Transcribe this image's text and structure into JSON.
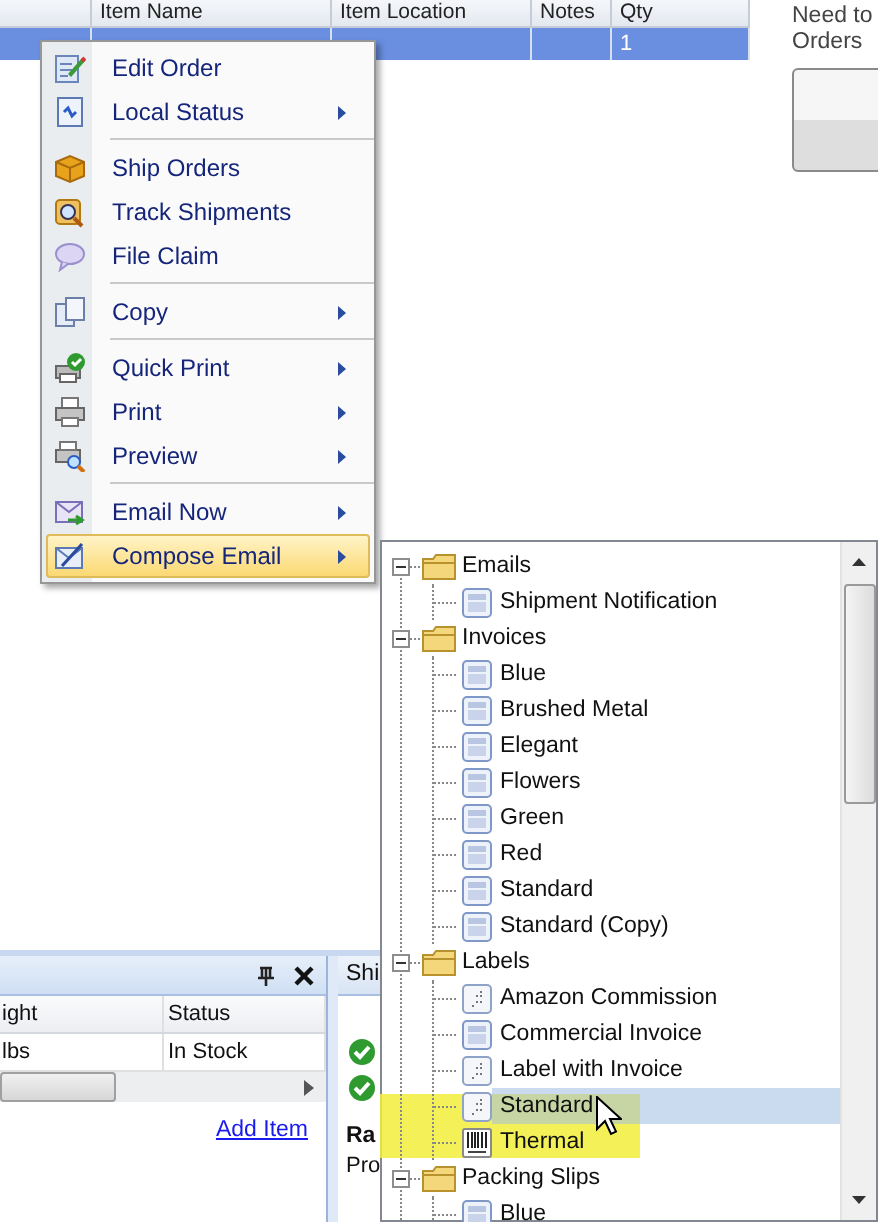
{
  "orders_table": {
    "columns": [
      "Item Name",
      "Item Location",
      "Notes",
      "Qty"
    ],
    "rows": [
      {
        "selected": true,
        "qty": "1"
      }
    ]
  },
  "side_panel": {
    "text_lines": [
      "Need to",
      "Orders"
    ]
  },
  "items_panel": {
    "columns": [
      "ight",
      "Status"
    ],
    "rows": [
      [
        "lbs",
        "In Stock"
      ]
    ],
    "link": "Add Item"
  },
  "shipments_panel": {
    "tab": "Shi",
    "heading": "Ra",
    "label": "Pro"
  },
  "context_menu": {
    "items": [
      {
        "kind": "item",
        "label": "Edit Order",
        "submenu": false,
        "selected": false
      },
      {
        "kind": "item",
        "label": "Local Status",
        "submenu": true,
        "selected": false
      },
      {
        "kind": "separator"
      },
      {
        "kind": "item",
        "label": "Ship Orders",
        "submenu": false,
        "selected": false
      },
      {
        "kind": "item",
        "label": "Track Shipments",
        "submenu": false,
        "selected": false
      },
      {
        "kind": "item",
        "label": "File Claim",
        "submenu": false,
        "selected": false
      },
      {
        "kind": "separator"
      },
      {
        "kind": "item",
        "label": "Copy",
        "submenu": true,
        "selected": false
      },
      {
        "kind": "separator"
      },
      {
        "kind": "item",
        "label": "Quick Print",
        "submenu": true,
        "selected": false
      },
      {
        "kind": "item",
        "label": "Print",
        "submenu": true,
        "selected": false
      },
      {
        "kind": "item",
        "label": "Preview",
        "submenu": true,
        "selected": false
      },
      {
        "kind": "separator"
      },
      {
        "kind": "item",
        "label": "Email Now",
        "submenu": true,
        "selected": false
      },
      {
        "kind": "item",
        "label": "Compose Email",
        "submenu": true,
        "selected": true
      }
    ]
  },
  "template_tree": {
    "groups": [
      {
        "label": "Emails",
        "expanded": true,
        "children": [
          {
            "label": "Shipment Notification",
            "kind": "document",
            "selected": false
          }
        ]
      },
      {
        "label": "Invoices",
        "expanded": true,
        "children": [
          {
            "label": "Blue",
            "kind": "document",
            "selected": false
          },
          {
            "label": "Brushed Metal",
            "kind": "document",
            "selected": false
          },
          {
            "label": "Elegant",
            "kind": "document",
            "selected": false
          },
          {
            "label": "Flowers",
            "kind": "document",
            "selected": false
          },
          {
            "label": "Green",
            "kind": "document",
            "selected": false
          },
          {
            "label": "Red",
            "kind": "document",
            "selected": false
          },
          {
            "label": "Standard",
            "kind": "document",
            "selected": false
          },
          {
            "label": "Standard (Copy)",
            "kind": "document",
            "selected": false
          }
        ]
      },
      {
        "label": "Labels",
        "expanded": true,
        "children": [
          {
            "label": "Amazon Commission",
            "kind": "label",
            "selected": false
          },
          {
            "label": "Commercial Invoice",
            "kind": "document",
            "selected": false
          },
          {
            "label": "Label with Invoice",
            "kind": "label",
            "selected": false
          },
          {
            "label": "Standard",
            "kind": "label",
            "selected": true
          },
          {
            "label": "Thermal",
            "kind": "barcode",
            "selected": false
          }
        ]
      },
      {
        "label": "Packing Slips",
        "expanded": true,
        "children": [
          {
            "label": "Blue",
            "kind": "document",
            "selected": false
          }
        ]
      }
    ]
  }
}
